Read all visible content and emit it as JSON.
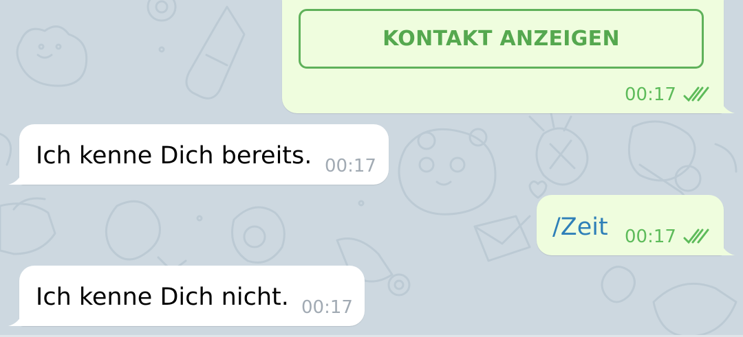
{
  "chat": {
    "background_color": "#cdd8e0",
    "messages": [
      {
        "direction": "outgoing",
        "button_label": "KONTAKT ANZEIGEN",
        "time": "00:17",
        "status": "read-double-check-icon"
      },
      {
        "direction": "incoming",
        "text": "Ich kenne Dich bereits.",
        "time": "00:17"
      },
      {
        "direction": "outgoing",
        "text": "/Zeit",
        "time": "00:17",
        "status": "read-double-check-icon"
      },
      {
        "direction": "incoming",
        "text": "Ich kenne Dich nicht.",
        "time": "00:17"
      }
    ]
  },
  "colors": {
    "outgoing_bubble": "#effdde",
    "incoming_bubble": "#ffffff",
    "outgoing_time": "#5dbb5a",
    "incoming_time": "#a1aab3",
    "command_link": "#2e7fb8",
    "button_accent": "#55a84f"
  }
}
